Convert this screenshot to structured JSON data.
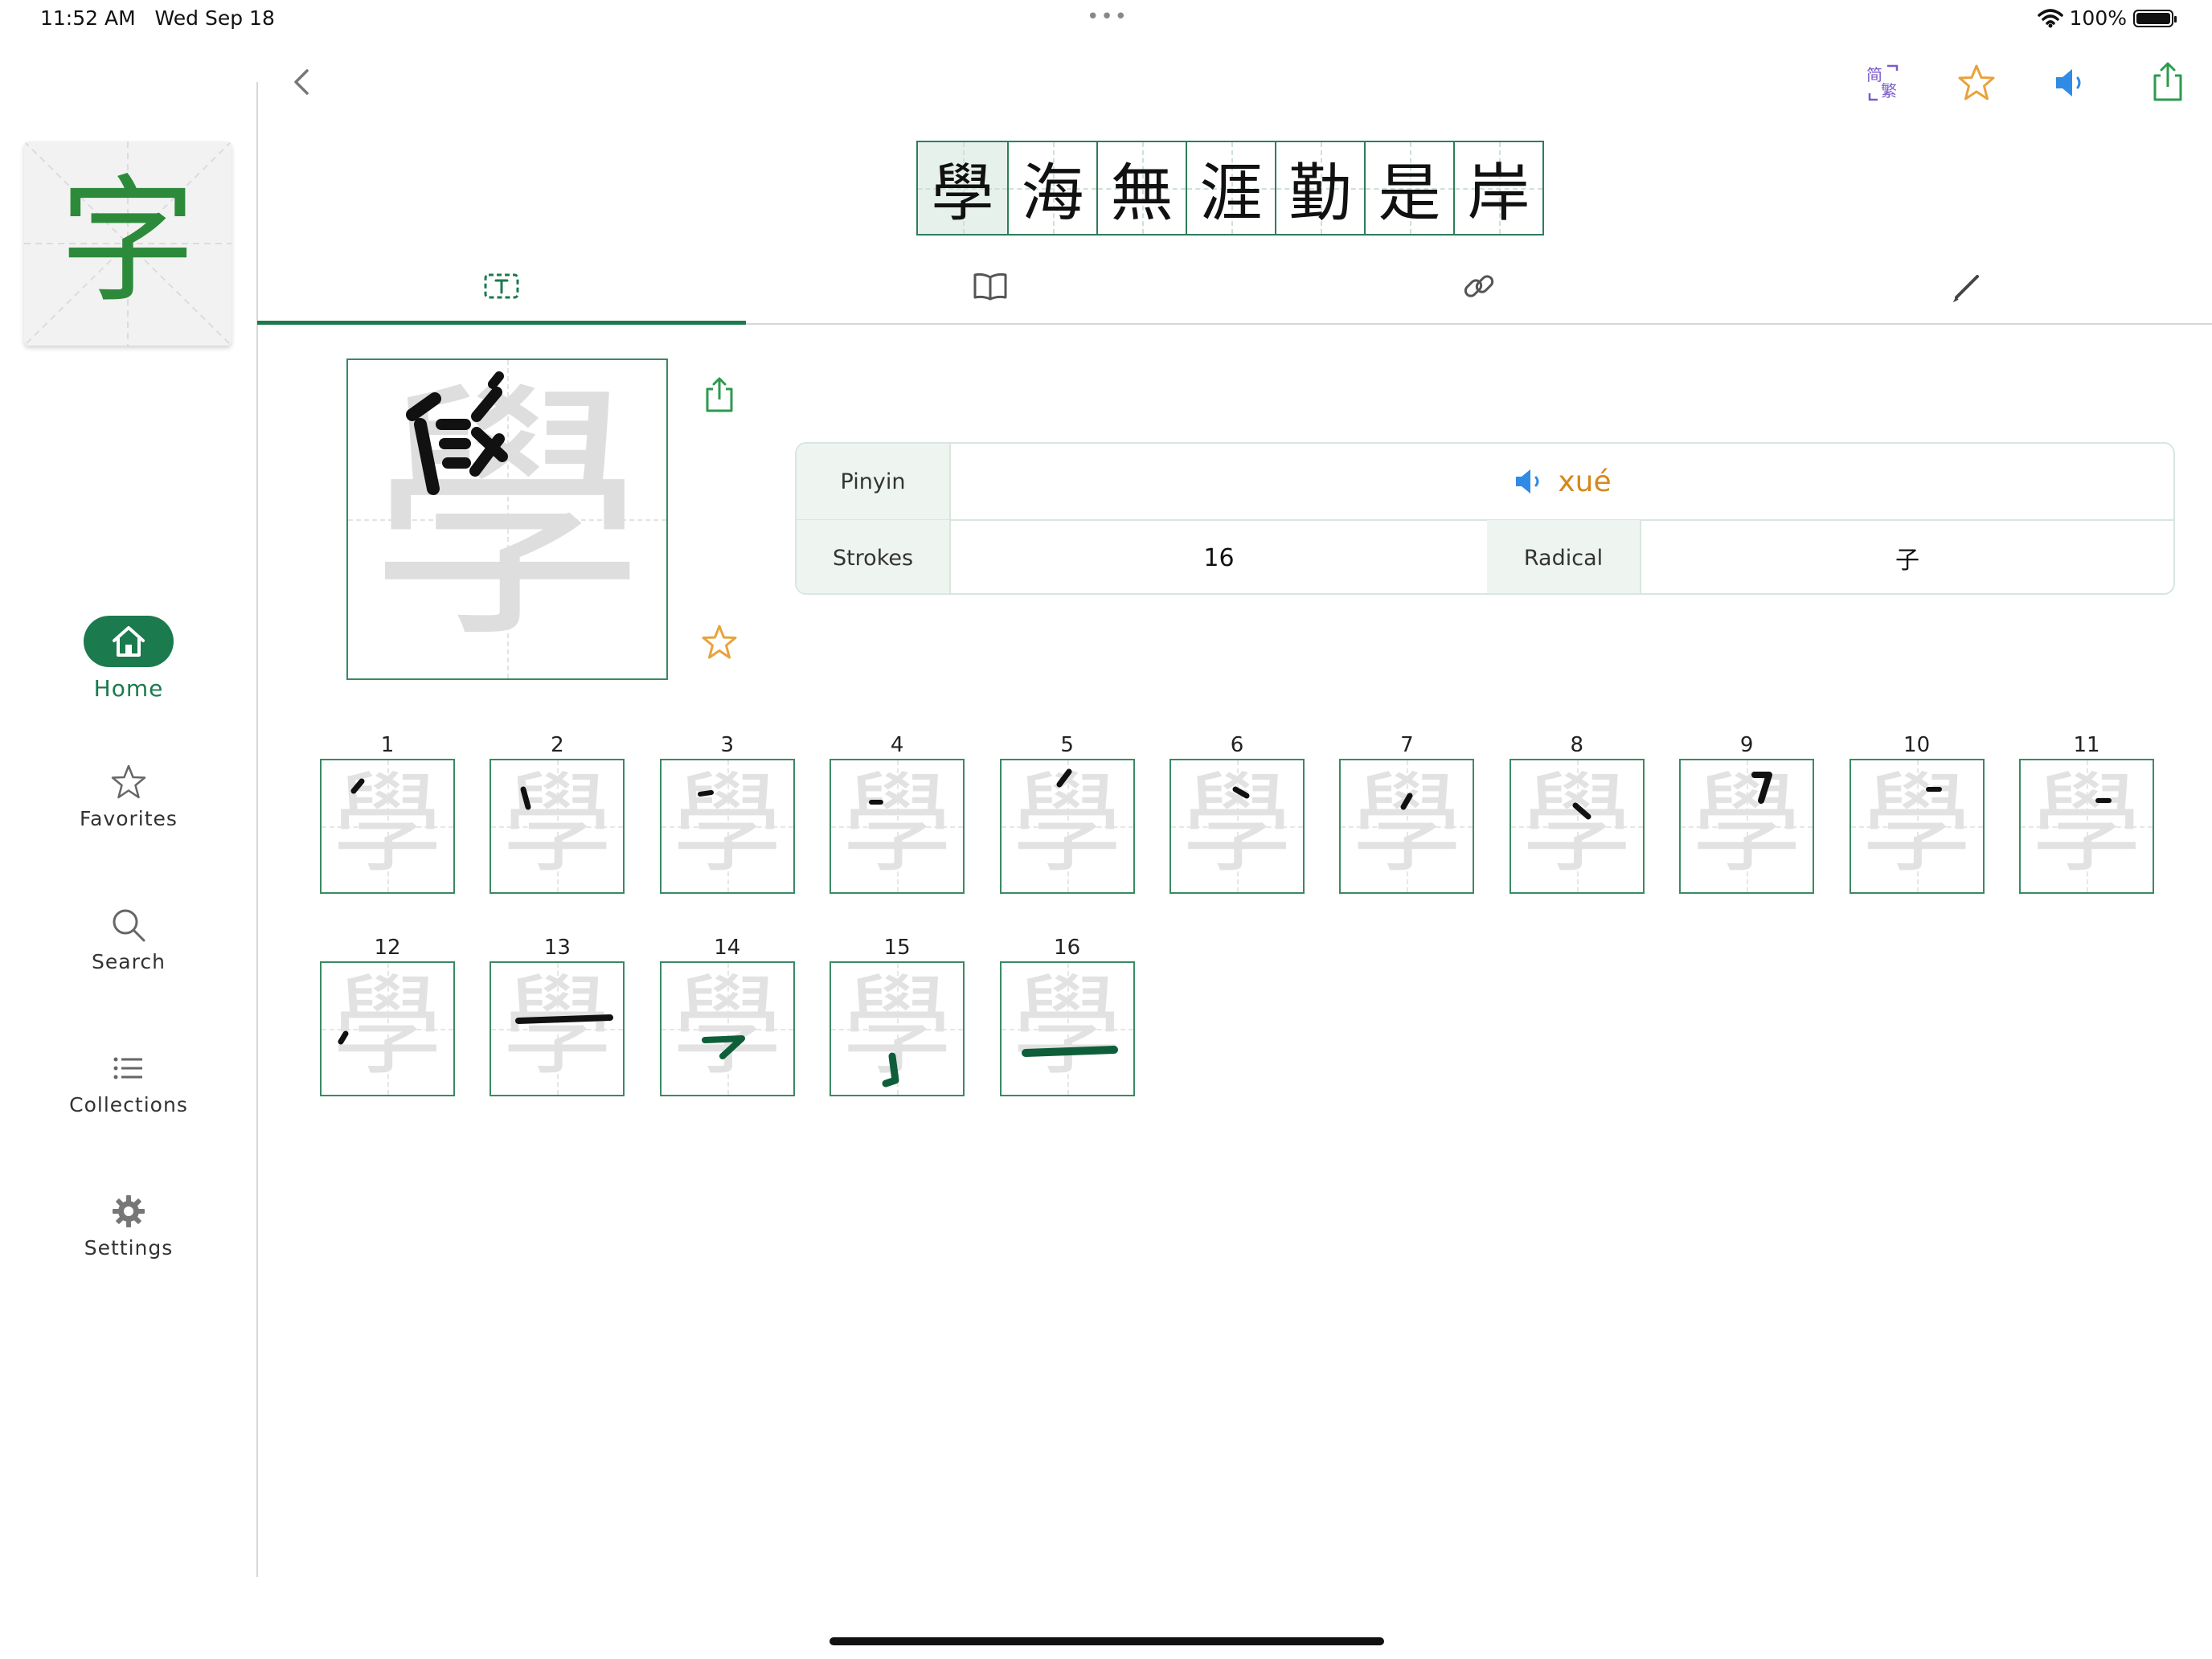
{
  "status": {
    "time": "11:52 AM",
    "date": "Wed Sep 18",
    "battery": "100%",
    "dots": "•••"
  },
  "app": {
    "logo_char": "字",
    "logo_color": "#2d8a3a"
  },
  "sidebar": {
    "items": [
      {
        "label": "Home",
        "icon": "home-icon",
        "active": true
      },
      {
        "label": "Favorites",
        "icon": "star-icon"
      },
      {
        "label": "Search",
        "icon": "search-icon"
      },
      {
        "label": "Collections",
        "icon": "list-icon"
      },
      {
        "label": "Settings",
        "icon": "gear-icon"
      }
    ]
  },
  "toolbar": {
    "icons": [
      "simplified-traditional-icon",
      "star-icon",
      "speaker-icon",
      "share-icon"
    ],
    "convert_top": "简",
    "convert_bottom": "繁"
  },
  "phrase": {
    "chars": [
      "學",
      "海",
      "無",
      "涯",
      "勤",
      "是",
      "岸"
    ],
    "selected_index": 0
  },
  "tabs": [
    {
      "name": "text-tab",
      "icon": "text-box-icon",
      "active": true
    },
    {
      "name": "dictionary-tab",
      "icon": "book-icon"
    },
    {
      "name": "links-tab",
      "icon": "link-icon"
    },
    {
      "name": "write-tab",
      "icon": "pencil-icon"
    }
  ],
  "character": {
    "glyph": "學",
    "pinyin_label": "Pinyin",
    "pinyin": "xué",
    "strokes_label": "Strokes",
    "strokes": "16",
    "radical_label": "Radical",
    "radical": "子"
  },
  "strokes": {
    "glyph": "學",
    "numbers": [
      "1",
      "2",
      "3",
      "4",
      "5",
      "6",
      "7",
      "8",
      "9",
      "10",
      "11",
      "12",
      "13",
      "14",
      "15",
      "16"
    ]
  },
  "colors": {
    "accent": "#1b7a4e",
    "star": "#e8a33a",
    "speaker": "#2f8be6",
    "convert": "#7b5ac9"
  }
}
